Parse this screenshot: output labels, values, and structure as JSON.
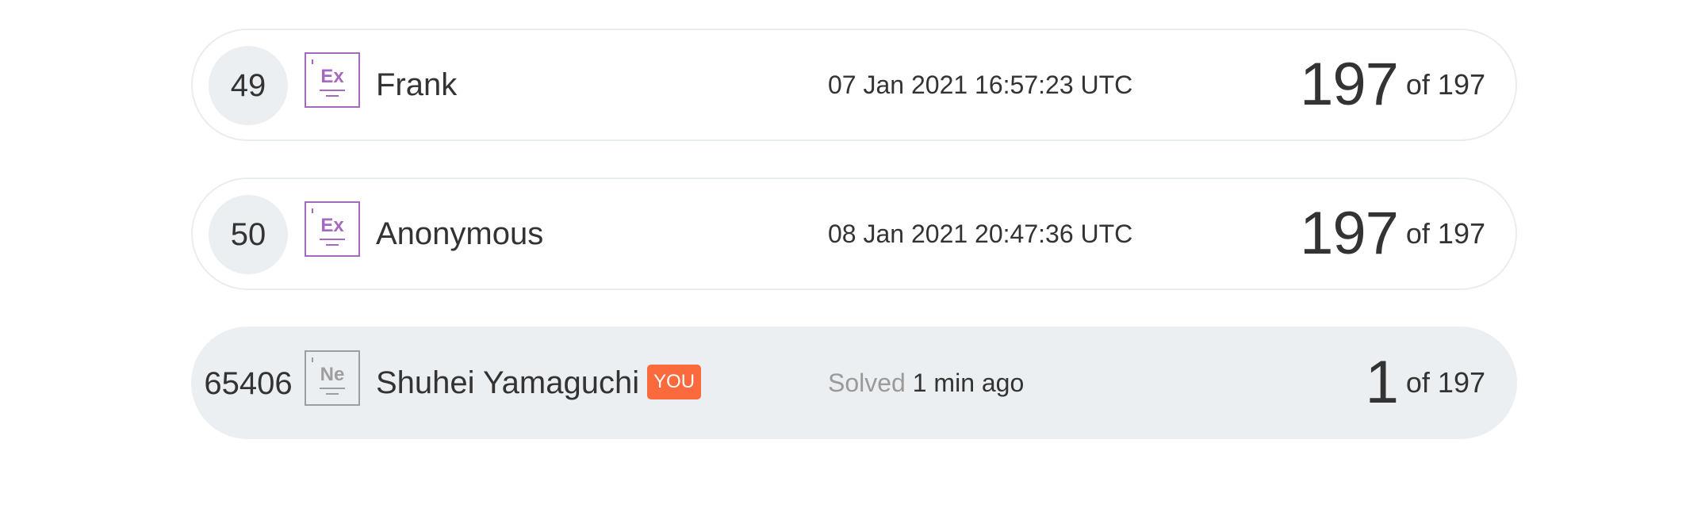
{
  "colors": {
    "tile_expert": "#a569bd",
    "tile_newbie": "#9e9e9e",
    "you_badge": "#fa6a3c",
    "row_highlight": "#ebeff1"
  },
  "rows": [
    {
      "rank": "49",
      "tile_symbol": "Ex",
      "tile_icon": "level-tile-icon",
      "name": "Frank",
      "time": "07 Jan 2021 16:57:23 UTC",
      "score": "197",
      "of_total": "of 197"
    },
    {
      "rank": "50",
      "tile_symbol": "Ex",
      "tile_icon": "level-tile-icon",
      "name": "Anonymous",
      "time": "08 Jan 2021 20:47:36 UTC",
      "score": "197",
      "of_total": "of 197"
    },
    {
      "rank": "65406",
      "tile_symbol": "Ne",
      "tile_icon": "level-tile-icon",
      "name": "Shuhei Yamaguchi",
      "you_badge": "YOU",
      "solved_label": "Solved",
      "solved_ago": "1 min ago",
      "score": "1",
      "of_total": "of 197"
    }
  ]
}
